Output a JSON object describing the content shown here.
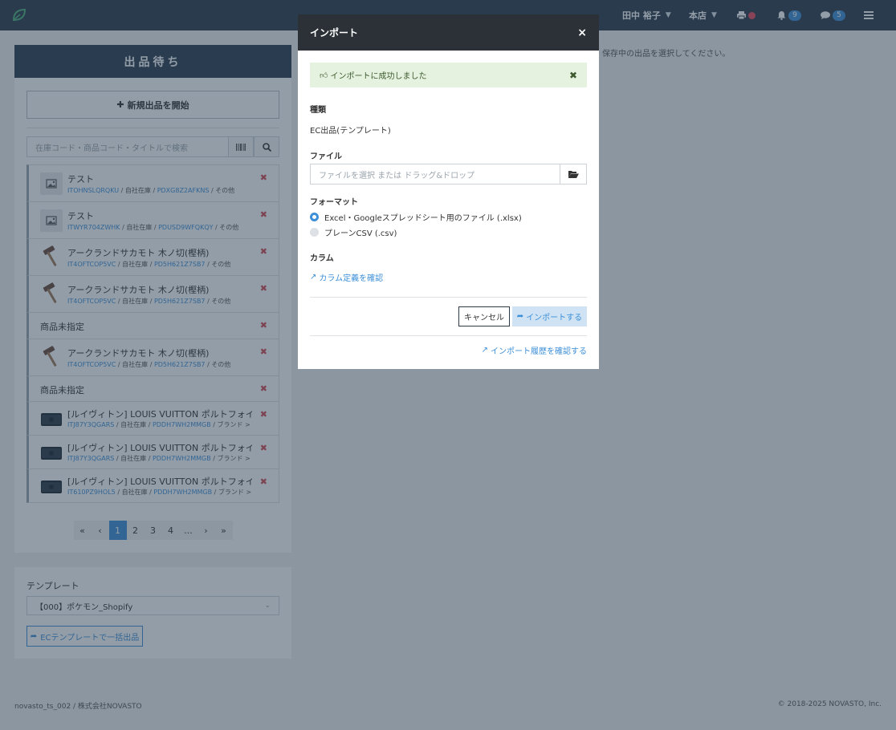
{
  "navbar": {
    "user": "田中 裕子",
    "store": "本店",
    "notifications_count": "9",
    "messages_count": "5"
  },
  "hint": "保存中の出品を選択してください。",
  "panel": {
    "title": "出品待ち",
    "new_button": "新規出品を開始",
    "search_placeholder": "在庫コード・商品コード・タイトルで検索",
    "items": [
      {
        "title": "テスト",
        "code1": "ITOHNSLQRQKU",
        "stock": "自社在庫",
        "code2": "PDXG8Z2AFKNS",
        "tail": "その他"
      },
      {
        "title": "テスト",
        "code1": "ITWYR704ZWHK",
        "stock": "自社在庫",
        "code2": "PDUSD9WFQKQY",
        "tail": "その他"
      },
      {
        "title": "アークランドサカモト 木ノ切(樫柄)",
        "code1": "IT4OFTCOP5VC",
        "stock": "自社在庫",
        "code2": "PD5H621Z7SB7",
        "tail": "その他"
      },
      {
        "title": "アークランドサカモト 木ノ切(樫柄)",
        "code1": "IT4OFTCOP5VC",
        "stock": "自社在庫",
        "code2": "PD5H621Z7SB7",
        "tail": "その他"
      },
      {
        "plain": "商品未指定"
      },
      {
        "title": "アークランドサカモト 木ノ切(樫柄)",
        "code1": "IT4OFTCOP5VC",
        "stock": "自社在庫",
        "code2": "PD5H621Z7SB7",
        "tail": "その他"
      },
      {
        "plain": "商品未指定"
      },
      {
        "title": "[ルイヴィトン] LOUIS VUITTON ポルトフォイユ・ヴィク...",
        "code1": "ITJ87Y3QGARS",
        "stock": "自社在庫",
        "code2": "PDDH7WH2MMGB",
        "tail": "ブランド > ..."
      },
      {
        "title": "[ルイヴィトン] LOUIS VUITTON ポルトフォイユ・ヴィク...",
        "code1": "ITJ87Y3QGARS",
        "stock": "自社在庫",
        "code2": "PDDH7WH2MMGB",
        "tail": "ブランド > ..."
      },
      {
        "title": "[ルイヴィトン] LOUIS VUITTON ポルトフォイユ・ヴィク...",
        "code1": "IT610PZ9HOL5",
        "stock": "自社在庫",
        "code2": "PDDH7WH2MMGB",
        "tail": "ブランド > ..."
      }
    ],
    "pagination": [
      "«",
      "‹",
      "1",
      "2",
      "3",
      "4",
      "...",
      "›",
      "»"
    ],
    "active_page": "1"
  },
  "template": {
    "label": "テンプレート",
    "selected": "【000】ポケモン_Shopify",
    "bulk_button": "ECテンプレートで一括出品"
  },
  "footer": {
    "left": "novasto_ts_002 / 株式会社NOVASTO",
    "right": "© 2018-2025 NOVASTO, Inc."
  },
  "modal": {
    "title": "インポート",
    "close": "×",
    "alert": "インポートに成功しました",
    "type_label": "種類",
    "type_value": "EC出品(テンプレート)",
    "file_label": "ファイル",
    "file_placeholder": "ファイルを選択 または ドラッグ&ドロップ",
    "format_label": "フォーマット",
    "format_options": [
      "Excel・Googleスプレッドシート用のファイル (.xlsx)",
      "プレーンCSV (.csv)"
    ],
    "column_label": "カラム",
    "column_link": "カラム定義を確認",
    "cancel": "キャンセル",
    "import": "インポートする",
    "history_link": "インポート履歴を確認する"
  },
  "colors": {
    "navbar": "#2c3a4a",
    "panel_header": "#2c3e50",
    "accent": "#3d8fd8",
    "danger": "#d34a54",
    "success_bg": "#e5f2df"
  }
}
